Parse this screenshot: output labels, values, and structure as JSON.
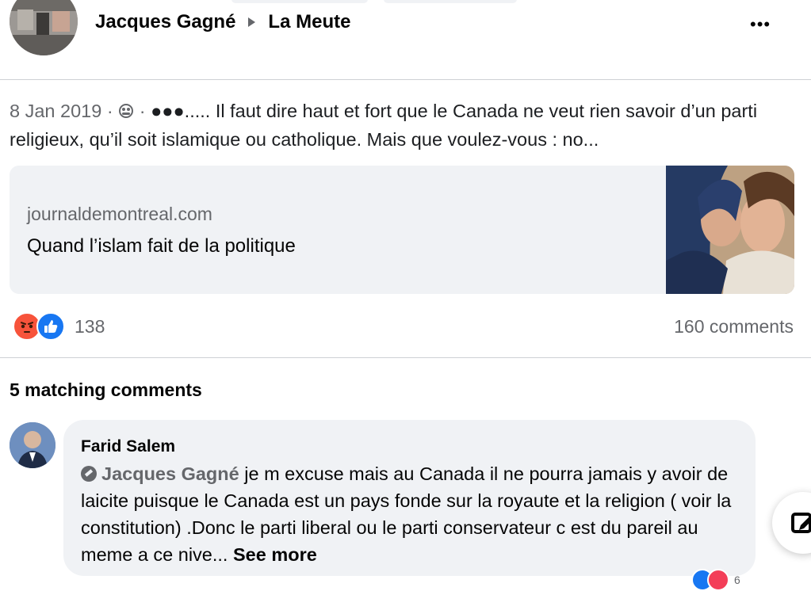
{
  "header": {
    "author": "Jacques Gagné",
    "group": "La Meute",
    "more_icon": "more-horizontal-icon"
  },
  "post": {
    "date": "8 Jan 2019",
    "separator": "·",
    "audience_icon": "group-privacy-icon",
    "text": "●●●..... Il faut dire haut et fort que le Canada ne veut rien savoir d’un parti religieux, qu’il soit islamique ou catholique. Mais que voulez-vous : no..."
  },
  "link_preview": {
    "domain": "journaldemontreal.com",
    "title": "Quand l’islam fait de la politique"
  },
  "engagement": {
    "reactions": [
      "angry-reaction-icon",
      "like-reaction-icon"
    ],
    "reaction_count": "138",
    "comments_count": "160 comments"
  },
  "comments_section": {
    "title": "5 matching comments"
  },
  "comment": {
    "author": "Farid Salem",
    "mention": "Jacques Gagné",
    "text": "je m excuse mais au Canada il ne pourra jamais y avoir de laicite puisque le Canada est un pays fonde sur la royaute et la religion ( voir la constitution) .Donc le parti liberal ou le parti conservateur c est du pareil au meme a ce nive...",
    "see_more": "See more",
    "reaction_icons": [
      "like-reaction-icon",
      "love-reaction-icon"
    ],
    "reaction_count": "6"
  },
  "colors": {
    "bubble": "#f0f2f5",
    "secondary_text": "#65676b",
    "like_blue": "#1877f2",
    "angry_orange": "#f7533b"
  }
}
